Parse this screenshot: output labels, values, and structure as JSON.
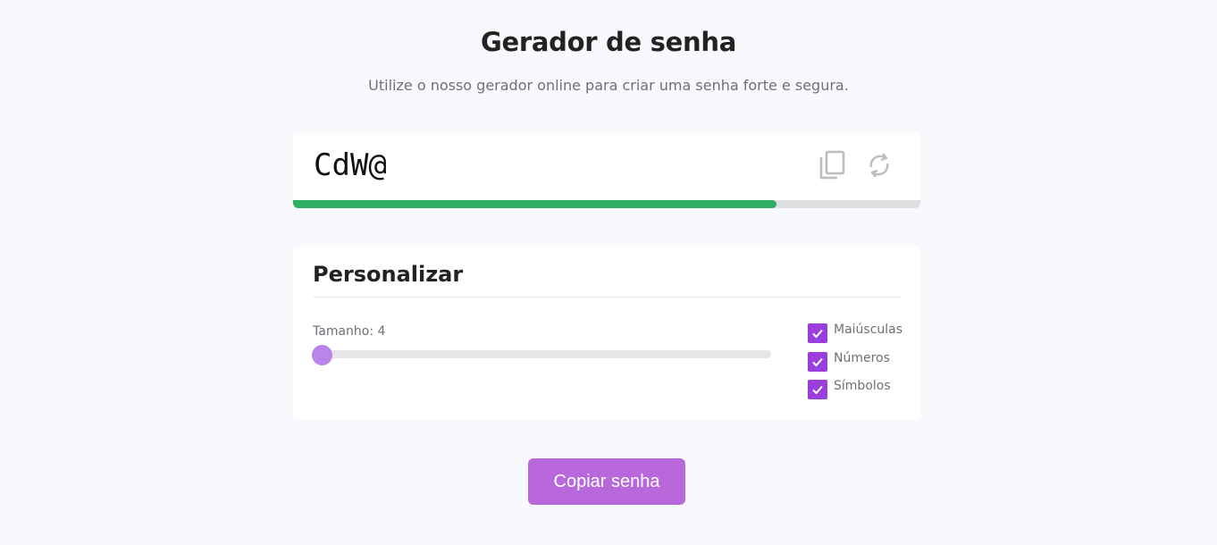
{
  "header": {
    "title": "Gerador de senha",
    "subtitle": "Utilize o nosso gerador online para criar uma senha forte e segura."
  },
  "password": {
    "value": "CdW@",
    "copy_icon": "copy-icon",
    "refresh_icon": "refresh-icon",
    "strength_fraction": 0.77,
    "strength_color": "#2eaf62"
  },
  "customize": {
    "title": "Personalizar",
    "length_label": "Tamanho: 4",
    "length_value": 4,
    "length_slider_fraction": 0.0,
    "options": [
      {
        "label": "Maiúsculas",
        "checked": true
      },
      {
        "label": "Números",
        "checked": true
      },
      {
        "label": "Símbolos",
        "checked": true
      }
    ]
  },
  "actions": {
    "copy_button_label": "Copiar senha"
  },
  "colors": {
    "accent": "#9a3fdc",
    "button": "#b968dc",
    "slider_thumb": "#bb84e8"
  }
}
